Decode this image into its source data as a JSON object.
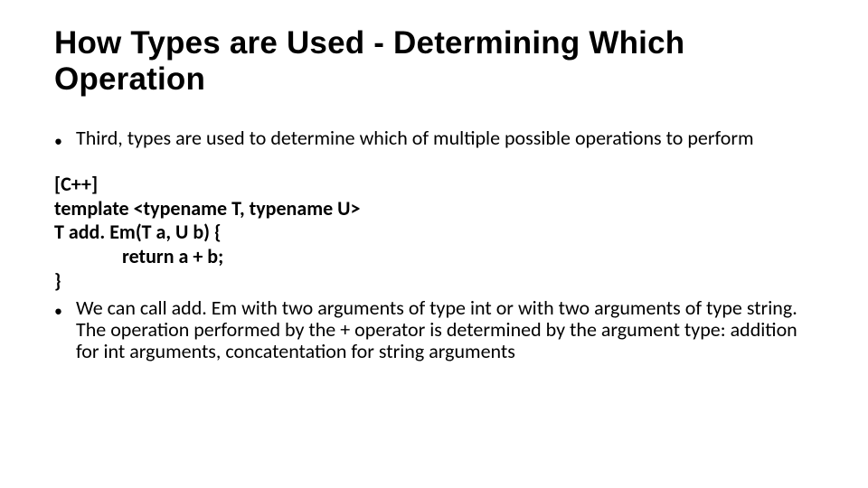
{
  "title": "How Types are Used - Determining Which Operation",
  "bullet1": "Third, types are used to determine which of multiple possible operations to perform",
  "code": {
    "l1": "[C++]",
    "l2": "template <typename T, typename U>",
    "l3": "T add. Em(T a, U b) {",
    "l4": "return a + b;",
    "l5": "}"
  },
  "bullet2": "We can call add. Em with two arguments of type int or with two arguments of type string. The operation performed by the + operator is determined by the argument type: addition for int arguments, concatentation for string arguments"
}
